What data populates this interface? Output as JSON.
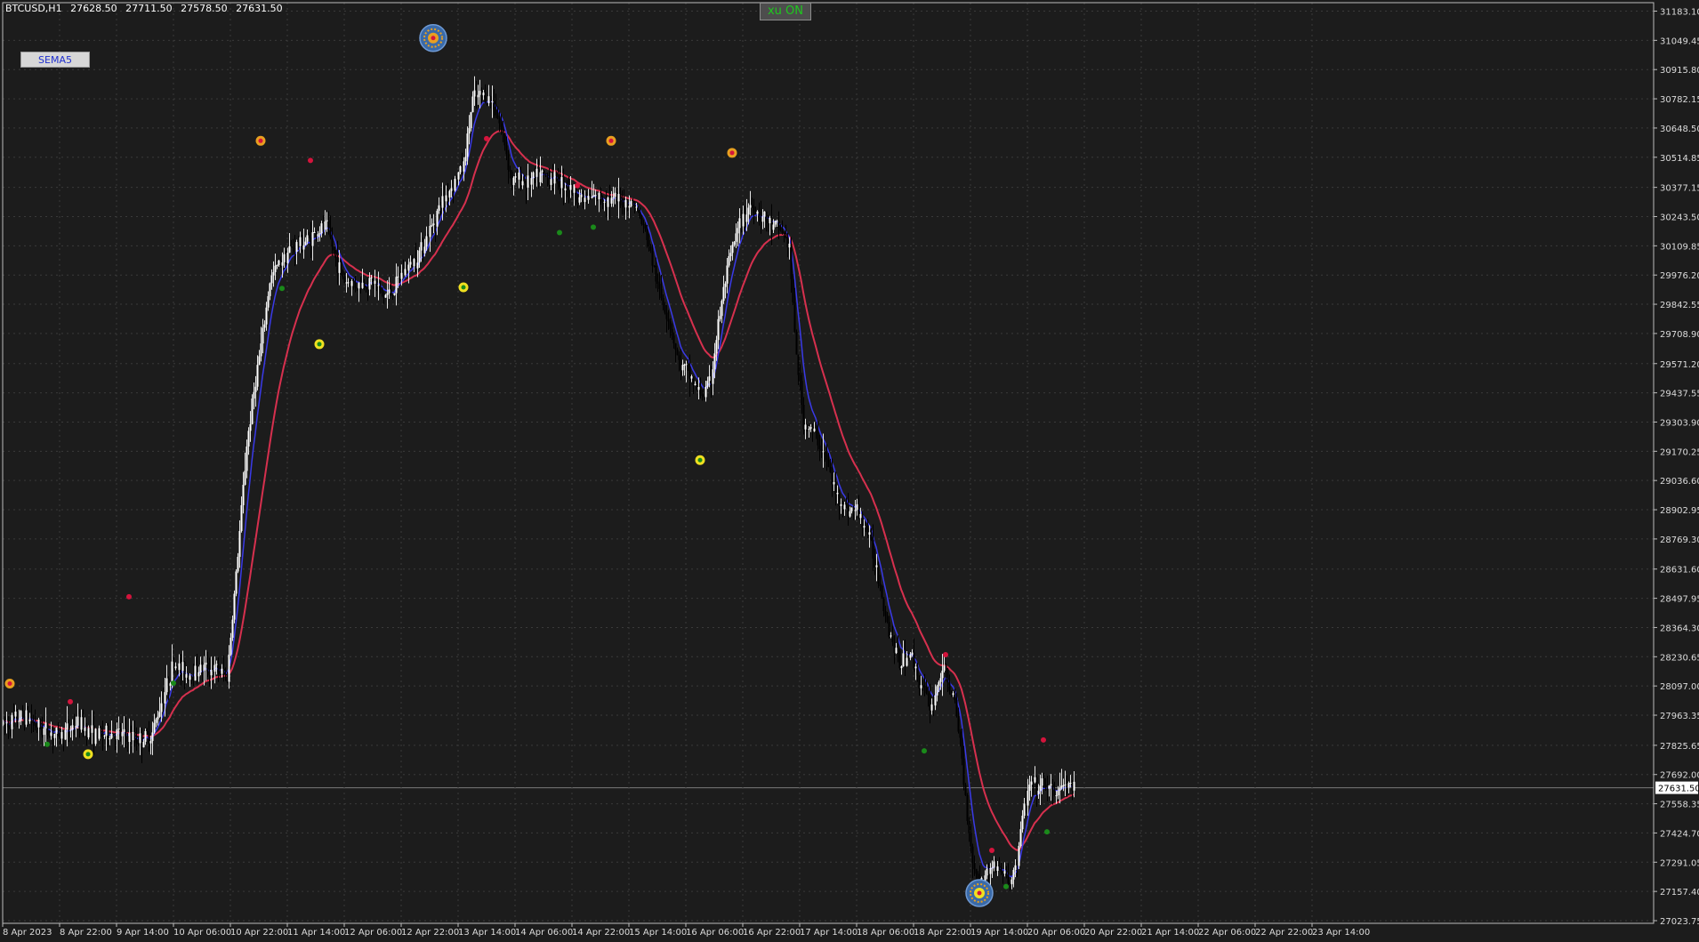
{
  "header": {
    "symbol": "BTCUSD,H1",
    "open": "27628.50",
    "high": "27711.50",
    "low": "27578.50",
    "close": "27631.50"
  },
  "buttons": {
    "sema_label": "SEMA5",
    "xu_label": "xu ON"
  },
  "colors": {
    "background": "#1c1c1c",
    "grid": "#3a3a3a",
    "bull_candle": "#ffffff",
    "bear_candle": "#000000",
    "fast_ma": "#3a3ae8",
    "slow_ma": "#d6304e",
    "top_marker": "#e8a020",
    "bottom_marker": "#f0e020",
    "minor_top_dot": "#d4143c",
    "minor_bottom_dot": "#1a8a1a"
  },
  "chart_data": {
    "type": "candlestick",
    "symbol": "BTCUSD",
    "timeframe": "H1",
    "ylim": [
      27023.75,
      31183.1
    ],
    "y_ticks": [
      "31183.10",
      "31049.45",
      "30915.80",
      "30782.15",
      "30648.50",
      "30514.85",
      "30377.15",
      "30243.50",
      "30109.85",
      "29976.20",
      "29842.55",
      "29708.90",
      "29571.20",
      "29437.55",
      "29303.90",
      "29170.25",
      "29036.60",
      "28902.95",
      "28769.30",
      "28631.60",
      "28497.95",
      "28364.30",
      "28230.65",
      "28097.00",
      "27963.35",
      "27825.65",
      "27692.00",
      "27558.35",
      "27424.70",
      "27291.05",
      "27157.40",
      "27023.75"
    ],
    "current_price_label": "27631.50",
    "current_price": 27631.5,
    "x_ticks": [
      "8 Apr 2023",
      "8 Apr 22:00",
      "9 Apr 14:00",
      "10 Apr 06:00",
      "10 Apr 22:00",
      "11 Apr 14:00",
      "12 Apr 06:00",
      "12 Apr 22:00",
      "13 Apr 14:00",
      "14 Apr 06:00",
      "14 Apr 22:00",
      "15 Apr 14:00",
      "16 Apr 06:00",
      "16 Apr 22:00",
      "17 Apr 14:00",
      "18 Apr 06:00",
      "18 Apr 22:00",
      "19 Apr 14:00",
      "20 Apr 06:00",
      "20 Apr 22:00",
      "21 Apr 14:00",
      "22 Apr 06:00",
      "22 Apr 22:00",
      "23 Apr 14:00"
    ],
    "bars_per_x_tick": 16,
    "total_bars": 370,
    "close_path": [
      [
        0,
        27920
      ],
      [
        12,
        27960
      ],
      [
        22,
        27900
      ],
      [
        32,
        27870
      ],
      [
        42,
        27930
      ],
      [
        52,
        27870
      ],
      [
        62,
        27880
      ],
      [
        78,
        27850
      ],
      [
        84,
        27880
      ],
      [
        88,
        28000
      ],
      [
        96,
        28200
      ],
      [
        104,
        28150
      ],
      [
        112,
        28180
      ],
      [
        120,
        28170
      ],
      [
        126,
        28140
      ],
      [
        132,
        28700
      ],
      [
        137,
        29200
      ],
      [
        142,
        29500
      ],
      [
        146,
        29700
      ],
      [
        150,
        29950
      ],
      [
        155,
        30030
      ],
      [
        162,
        30100
      ],
      [
        170,
        30130
      ],
      [
        176,
        30170
      ],
      [
        182,
        30200
      ],
      [
        187,
        30050
      ],
      [
        192,
        29950
      ],
      [
        200,
        29930
      ],
      [
        208,
        29950
      ],
      [
        214,
        29880
      ],
      [
        219,
        29900
      ],
      [
        224,
        29980
      ],
      [
        232,
        30050
      ],
      [
        240,
        30180
      ],
      [
        246,
        30300
      ],
      [
        252,
        30380
      ],
      [
        259,
        30480
      ],
      [
        264,
        30780
      ],
      [
        270,
        30800
      ],
      [
        276,
        30760
      ],
      [
        282,
        30580
      ],
      [
        286,
        30400
      ],
      [
        290,
        30420
      ],
      [
        295,
        30400
      ],
      [
        302,
        30430
      ],
      [
        310,
        30420
      ],
      [
        318,
        30380
      ],
      [
        326,
        30320
      ],
      [
        334,
        30330
      ],
      [
        342,
        30320
      ],
      [
        350,
        30310
      ],
      [
        355,
        30300
      ],
      [
        362,
        30150
      ],
      [
        368,
        29920
      ],
      [
        374,
        29780
      ],
      [
        380,
        29570
      ],
      [
        386,
        29520
      ],
      [
        390,
        29450
      ],
      [
        394,
        29430
      ],
      [
        398,
        29500
      ],
      [
        402,
        29750
      ],
      [
        406,
        29950
      ],
      [
        410,
        30100
      ],
      [
        414,
        30200
      ],
      [
        420,
        30300
      ],
      [
        426,
        30250
      ],
      [
        432,
        30200
      ],
      [
        438,
        30180
      ],
      [
        442,
        30100
      ],
      [
        445,
        29700
      ],
      [
        450,
        29300
      ],
      [
        456,
        29250
      ],
      [
        462,
        29150
      ],
      [
        468,
        28980
      ],
      [
        474,
        28900
      ],
      [
        480,
        28900
      ],
      [
        486,
        28800
      ],
      [
        492,
        28600
      ],
      [
        498,
        28350
      ],
      [
        504,
        28200
      ],
      [
        510,
        28250
      ],
      [
        516,
        28100
      ],
      [
        522,
        28000
      ],
      [
        528,
        28180
      ],
      [
        534,
        28050
      ],
      [
        538,
        27850
      ],
      [
        542,
        27500
      ],
      [
        546,
        27250
      ],
      [
        550,
        27200
      ],
      [
        556,
        27280
      ],
      [
        562,
        27250
      ],
      [
        566,
        27190
      ],
      [
        570,
        27300
      ],
      [
        574,
        27550
      ],
      [
        578,
        27650
      ],
      [
        582,
        27620
      ],
      [
        586,
        27650
      ],
      [
        590,
        27600
      ],
      [
        594,
        27630
      ],
      [
        598,
        27640
      ],
      [
        602,
        27631
      ]
    ],
    "moving_averages": [
      {
        "name": "fast",
        "color": "#3a3ae8"
      },
      {
        "name": "slow",
        "color": "#d6304e"
      }
    ],
    "markers": [
      {
        "kind": "top",
        "time_index": 4,
        "price": 28108
      },
      {
        "kind": "bottom",
        "time_index": 48,
        "price": 27785
      },
      {
        "kind": "top",
        "time_index": 145,
        "price": 30590
      },
      {
        "kind": "bottom",
        "time_index": 178,
        "price": 29660
      },
      {
        "kind": "major-top",
        "time_index": 242,
        "price": 31060
      },
      {
        "kind": "bottom",
        "time_index": 259,
        "price": 29920
      },
      {
        "kind": "top",
        "time_index": 342,
        "price": 30590
      },
      {
        "kind": "bottom",
        "time_index": 392,
        "price": 29130
      },
      {
        "kind": "top",
        "time_index": 410,
        "price": 30535
      },
      {
        "kind": "major-bottom",
        "time_index": 549,
        "price": 27150
      }
    ],
    "minor_dots": [
      {
        "kind": "top",
        "time_index": 38,
        "price": 28025
      },
      {
        "kind": "bottom",
        "time_index": 25,
        "price": 27830
      },
      {
        "kind": "top",
        "time_index": 71,
        "price": 28505
      },
      {
        "kind": "bottom",
        "time_index": 96,
        "price": 28110
      },
      {
        "kind": "bottom",
        "time_index": 157,
        "price": 29915
      },
      {
        "kind": "top",
        "time_index": 173,
        "price": 30500
      },
      {
        "kind": "top",
        "time_index": 272,
        "price": 30600
      },
      {
        "kind": "bottom",
        "time_index": 313,
        "price": 30170
      },
      {
        "kind": "top",
        "time_index": 323,
        "price": 30385
      },
      {
        "kind": "bottom",
        "time_index": 332,
        "price": 30195
      },
      {
        "kind": "top",
        "time_index": 530,
        "price": 28240
      },
      {
        "kind": "bottom",
        "time_index": 518,
        "price": 27800
      },
      {
        "kind": "top",
        "time_index": 556,
        "price": 27345
      },
      {
        "kind": "bottom",
        "time_index": 564,
        "price": 27180
      },
      {
        "kind": "top",
        "time_index": 585,
        "price": 27850
      },
      {
        "kind": "bottom",
        "time_index": 587,
        "price": 27430
      }
    ]
  }
}
